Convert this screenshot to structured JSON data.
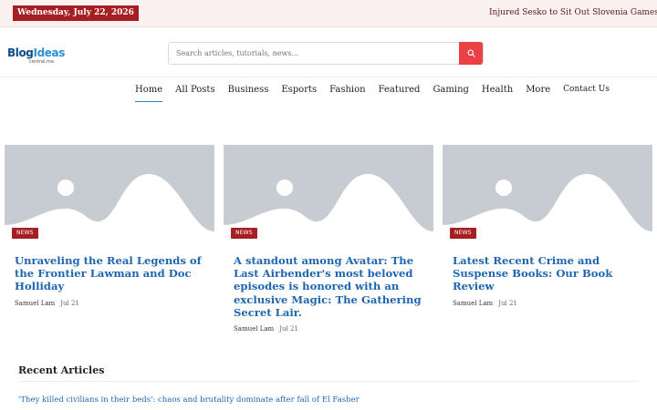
{
  "topbar": {
    "date": "Wednesday, July 22, 2026",
    "ticker": "Injured Sesko to Sit Out Slovenia Games but United H"
  },
  "logo": {
    "main_a": "Blog",
    "main_b": "Ideas",
    "sub": "central.ma"
  },
  "search": {
    "placeholder": "Search articles, tutorials, news..."
  },
  "nav": {
    "items": [
      {
        "label": "Home",
        "active": true
      },
      {
        "label": "All Posts"
      },
      {
        "label": "Business"
      },
      {
        "label": "Esports"
      },
      {
        "label": "Fashion"
      },
      {
        "label": "Featured"
      },
      {
        "label": "Gaming"
      },
      {
        "label": "Health"
      },
      {
        "label": "More"
      },
      {
        "label": "Contact Us"
      }
    ]
  },
  "cards": [
    {
      "badge": "NEWS",
      "title": "Unraveling the Real Legends of the Frontier Lawman and Doc Holliday",
      "author": "Samuel Lam",
      "date": "Jul 21"
    },
    {
      "badge": "NEWS",
      "title": "A standout among Avatar: The Last Airbender's most beloved episodes is honored with an exclusive Magic: The Gathering Secret Lair.",
      "author": "Samuel Lam",
      "date": "Jul 21"
    },
    {
      "badge": "NEWS",
      "title": "Latest Recent Crime and Suspense Books: Our Book Review",
      "author": "Samuel Lam",
      "date": "Jul 21"
    }
  ],
  "recent": {
    "title": "Recent Articles",
    "items": [
      "'They killed civilians in their beds': chaos and brutality dominate after fall of El Fasher"
    ]
  },
  "colors": {
    "brand_red": "#a51e22",
    "search_red": "#ea4147",
    "link_blue": "#1e66b0",
    "placeholder_gray": "#c7ccd3"
  }
}
